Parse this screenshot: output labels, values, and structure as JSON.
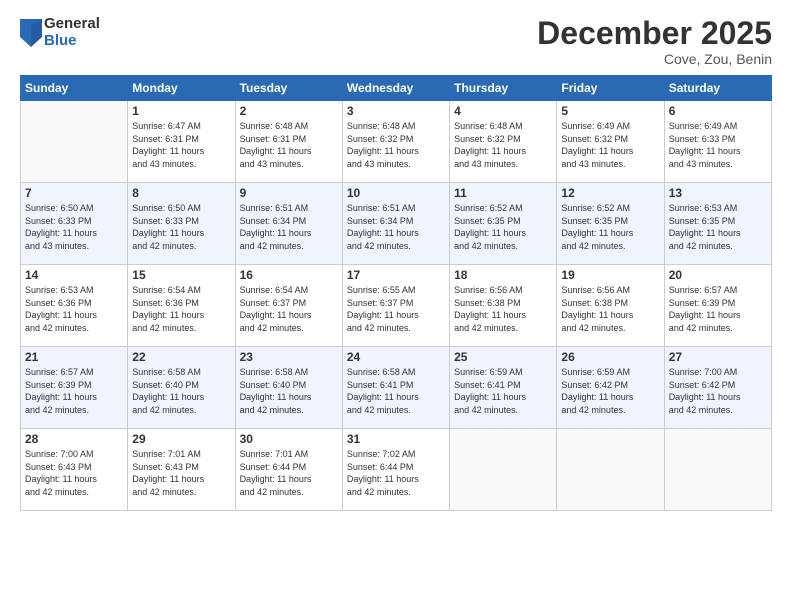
{
  "logo": {
    "general": "General",
    "blue": "Blue"
  },
  "title": "December 2025",
  "location": "Cove, Zou, Benin",
  "days_of_week": [
    "Sunday",
    "Monday",
    "Tuesday",
    "Wednesday",
    "Thursday",
    "Friday",
    "Saturday"
  ],
  "weeks": [
    [
      {
        "day": "",
        "sunrise": "",
        "sunset": "",
        "daylight": ""
      },
      {
        "day": "1",
        "sunrise": "Sunrise: 6:47 AM",
        "sunset": "Sunset: 6:31 PM",
        "daylight": "Daylight: 11 hours and 43 minutes."
      },
      {
        "day": "2",
        "sunrise": "Sunrise: 6:48 AM",
        "sunset": "Sunset: 6:31 PM",
        "daylight": "Daylight: 11 hours and 43 minutes."
      },
      {
        "day": "3",
        "sunrise": "Sunrise: 6:48 AM",
        "sunset": "Sunset: 6:32 PM",
        "daylight": "Daylight: 11 hours and 43 minutes."
      },
      {
        "day": "4",
        "sunrise": "Sunrise: 6:48 AM",
        "sunset": "Sunset: 6:32 PM",
        "daylight": "Daylight: 11 hours and 43 minutes."
      },
      {
        "day": "5",
        "sunrise": "Sunrise: 6:49 AM",
        "sunset": "Sunset: 6:32 PM",
        "daylight": "Daylight: 11 hours and 43 minutes."
      },
      {
        "day": "6",
        "sunrise": "Sunrise: 6:49 AM",
        "sunset": "Sunset: 6:33 PM",
        "daylight": "Daylight: 11 hours and 43 minutes."
      }
    ],
    [
      {
        "day": "7",
        "sunrise": "Sunrise: 6:50 AM",
        "sunset": "Sunset: 6:33 PM",
        "daylight": "Daylight: 11 hours and 43 minutes."
      },
      {
        "day": "8",
        "sunrise": "Sunrise: 6:50 AM",
        "sunset": "Sunset: 6:33 PM",
        "daylight": "Daylight: 11 hours and 42 minutes."
      },
      {
        "day": "9",
        "sunrise": "Sunrise: 6:51 AM",
        "sunset": "Sunset: 6:34 PM",
        "daylight": "Daylight: 11 hours and 42 minutes."
      },
      {
        "day": "10",
        "sunrise": "Sunrise: 6:51 AM",
        "sunset": "Sunset: 6:34 PM",
        "daylight": "Daylight: 11 hours and 42 minutes."
      },
      {
        "day": "11",
        "sunrise": "Sunrise: 6:52 AM",
        "sunset": "Sunset: 6:35 PM",
        "daylight": "Daylight: 11 hours and 42 minutes."
      },
      {
        "day": "12",
        "sunrise": "Sunrise: 6:52 AM",
        "sunset": "Sunset: 6:35 PM",
        "daylight": "Daylight: 11 hours and 42 minutes."
      },
      {
        "day": "13",
        "sunrise": "Sunrise: 6:53 AM",
        "sunset": "Sunset: 6:35 PM",
        "daylight": "Daylight: 11 hours and 42 minutes."
      }
    ],
    [
      {
        "day": "14",
        "sunrise": "Sunrise: 6:53 AM",
        "sunset": "Sunset: 6:36 PM",
        "daylight": "Daylight: 11 hours and 42 minutes."
      },
      {
        "day": "15",
        "sunrise": "Sunrise: 6:54 AM",
        "sunset": "Sunset: 6:36 PM",
        "daylight": "Daylight: 11 hours and 42 minutes."
      },
      {
        "day": "16",
        "sunrise": "Sunrise: 6:54 AM",
        "sunset": "Sunset: 6:37 PM",
        "daylight": "Daylight: 11 hours and 42 minutes."
      },
      {
        "day": "17",
        "sunrise": "Sunrise: 6:55 AM",
        "sunset": "Sunset: 6:37 PM",
        "daylight": "Daylight: 11 hours and 42 minutes."
      },
      {
        "day": "18",
        "sunrise": "Sunrise: 6:56 AM",
        "sunset": "Sunset: 6:38 PM",
        "daylight": "Daylight: 11 hours and 42 minutes."
      },
      {
        "day": "19",
        "sunrise": "Sunrise: 6:56 AM",
        "sunset": "Sunset: 6:38 PM",
        "daylight": "Daylight: 11 hours and 42 minutes."
      },
      {
        "day": "20",
        "sunrise": "Sunrise: 6:57 AM",
        "sunset": "Sunset: 6:39 PM",
        "daylight": "Daylight: 11 hours and 42 minutes."
      }
    ],
    [
      {
        "day": "21",
        "sunrise": "Sunrise: 6:57 AM",
        "sunset": "Sunset: 6:39 PM",
        "daylight": "Daylight: 11 hours and 42 minutes."
      },
      {
        "day": "22",
        "sunrise": "Sunrise: 6:58 AM",
        "sunset": "Sunset: 6:40 PM",
        "daylight": "Daylight: 11 hours and 42 minutes."
      },
      {
        "day": "23",
        "sunrise": "Sunrise: 6:58 AM",
        "sunset": "Sunset: 6:40 PM",
        "daylight": "Daylight: 11 hours and 42 minutes."
      },
      {
        "day": "24",
        "sunrise": "Sunrise: 6:58 AM",
        "sunset": "Sunset: 6:41 PM",
        "daylight": "Daylight: 11 hours and 42 minutes."
      },
      {
        "day": "25",
        "sunrise": "Sunrise: 6:59 AM",
        "sunset": "Sunset: 6:41 PM",
        "daylight": "Daylight: 11 hours and 42 minutes."
      },
      {
        "day": "26",
        "sunrise": "Sunrise: 6:59 AM",
        "sunset": "Sunset: 6:42 PM",
        "daylight": "Daylight: 11 hours and 42 minutes."
      },
      {
        "day": "27",
        "sunrise": "Sunrise: 7:00 AM",
        "sunset": "Sunset: 6:42 PM",
        "daylight": "Daylight: 11 hours and 42 minutes."
      }
    ],
    [
      {
        "day": "28",
        "sunrise": "Sunrise: 7:00 AM",
        "sunset": "Sunset: 6:43 PM",
        "daylight": "Daylight: 11 hours and 42 minutes."
      },
      {
        "day": "29",
        "sunrise": "Sunrise: 7:01 AM",
        "sunset": "Sunset: 6:43 PM",
        "daylight": "Daylight: 11 hours and 42 minutes."
      },
      {
        "day": "30",
        "sunrise": "Sunrise: 7:01 AM",
        "sunset": "Sunset: 6:44 PM",
        "daylight": "Daylight: 11 hours and 42 minutes."
      },
      {
        "day": "31",
        "sunrise": "Sunrise: 7:02 AM",
        "sunset": "Sunset: 6:44 PM",
        "daylight": "Daylight: 11 hours and 42 minutes."
      },
      {
        "day": "",
        "sunrise": "",
        "sunset": "",
        "daylight": ""
      },
      {
        "day": "",
        "sunrise": "",
        "sunset": "",
        "daylight": ""
      },
      {
        "day": "",
        "sunrise": "",
        "sunset": "",
        "daylight": ""
      }
    ]
  ]
}
